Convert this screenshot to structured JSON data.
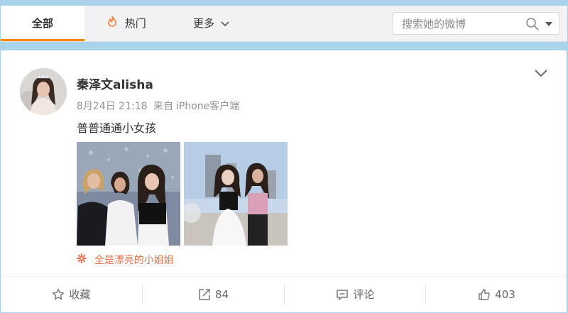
{
  "tabs": {
    "all": "全部",
    "hot": "热门",
    "more": "更多"
  },
  "search": {
    "placeholder": "搜索她的微博"
  },
  "post": {
    "username": "秦泽文alisha",
    "date": "8月24日 21:18",
    "source_prefix": "来自",
    "source": "iPhone客户端",
    "text": "普普通通小女孩",
    "tag": "全是漂亮的小姐姐"
  },
  "actions": {
    "favorite": "收藏",
    "repost_count": "84",
    "comment": "评论",
    "like_count": "403"
  },
  "colors": {
    "accent": "#ff8200",
    "tag": "#eb7350",
    "background": "#a9d3ea"
  },
  "icons": [
    "fire-icon",
    "chevron-down-icon",
    "search-icon",
    "dropdown-icon",
    "star-icon",
    "repost-icon",
    "comment-icon",
    "like-icon",
    "flower-icon"
  ]
}
